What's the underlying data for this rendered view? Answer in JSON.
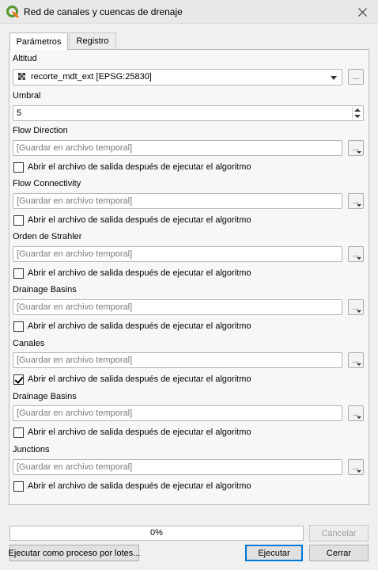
{
  "window": {
    "title": "Red de canales y cuencas de drenaje"
  },
  "tabs": [
    {
      "label": "Parámetros"
    },
    {
      "label": "Registro"
    }
  ],
  "params": {
    "altitud": {
      "label": "Altitud",
      "value": "recorte_mdt_ext [EPSG:25830]"
    },
    "umbral": {
      "label": "Umbral",
      "value": "5"
    },
    "outputs": [
      {
        "label": "Flow Direction",
        "placeholder": "[Guardar en archivo temporal]",
        "open_label": "Abrir el archivo de salida después de ejecutar el algoritmo",
        "checked": false
      },
      {
        "label": "Flow Connectivity",
        "placeholder": "[Guardar en archivo temporal]",
        "open_label": "Abrir el archivo de salida después de ejecutar el algoritmo",
        "checked": false
      },
      {
        "label": "Orden de Strahler",
        "placeholder": "[Guardar en archivo temporal]",
        "open_label": "Abrir el archivo de salida después de ejecutar el algoritmo",
        "checked": false
      },
      {
        "label": "Drainage Basins",
        "placeholder": "[Guardar en archivo temporal]",
        "open_label": "Abrir el archivo de salida después de ejecutar el algoritmo",
        "checked": false
      },
      {
        "label": "Canales",
        "placeholder": "[Guardar en archivo temporal]",
        "open_label": "Abrir el archivo de salida después de ejecutar el algoritmo",
        "checked": true
      },
      {
        "label": "Drainage Basins",
        "placeholder": "[Guardar en archivo temporal]",
        "open_label": "Abrir el archivo de salida después de ejecutar el algoritmo",
        "checked": false
      },
      {
        "label": "Junctions",
        "placeholder": "[Guardar en archivo temporal]",
        "open_label": "Abrir el archivo de salida después de ejecutar el algoritmo",
        "checked": false
      }
    ],
    "browse_label": "..."
  },
  "footer": {
    "progress": 0,
    "progress_text": "0%",
    "cancel": "Cancelar",
    "batch": "Ejecutar como proceso por lotes...",
    "run": "Ejecutar",
    "close": "Cerrar"
  },
  "colors": {
    "accent": "#0078d7",
    "qgis_green": "#589632",
    "qgis_yellow": "#ee7913"
  },
  "icons": {
    "app": "qgis-icon",
    "close": "close-icon",
    "raster": "raster-layer-icon"
  }
}
